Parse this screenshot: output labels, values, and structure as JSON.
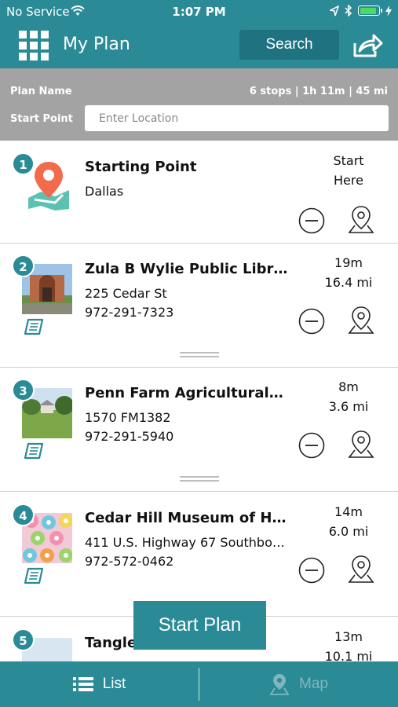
{
  "status_bar": {
    "carrier": "No Service",
    "time": "1:07 PM"
  },
  "header": {
    "title": "My Plan",
    "search_label": "Search",
    "menu_icon": "grid-menu-icon",
    "share_icon": "share-icon"
  },
  "plan": {
    "name_label": "Plan Name",
    "summary": "6 stops | 1h 11m | 45 mi",
    "start_label": "Start Point",
    "start_placeholder": "Enter Location"
  },
  "stops": [
    {
      "number": "1",
      "name": "Starting Point",
      "address": "Dallas",
      "phone": "",
      "time": "Start",
      "distance": "Here"
    },
    {
      "number": "2",
      "name": "Zula B Wylie Public Libra…",
      "address": "225 Cedar St",
      "phone": "972-291-7323",
      "time": "19m",
      "distance": "16.4 mi"
    },
    {
      "number": "3",
      "name": "Penn Farm Agricultural…",
      "address": "1570 FM1382",
      "phone": "972-291-5940",
      "time": "8m",
      "distance": "3.6 mi"
    },
    {
      "number": "4",
      "name": "Cedar Hill Museum of Hi…",
      "address": "411 U.S. Highway 67 Southbou…",
      "phone": "972-572-0462",
      "time": "14m",
      "distance": "6.0 mi"
    },
    {
      "number": "5",
      "name": "Tangle…",
      "address": "",
      "phone": "",
      "time": "13m",
      "distance": "10.1 mi"
    }
  ],
  "start_plan_label": "Start Plan",
  "tabs": {
    "list": "List",
    "map": "Map"
  },
  "colors": {
    "accent": "#2a8a96",
    "meta_bar": "#a3a3a3"
  }
}
